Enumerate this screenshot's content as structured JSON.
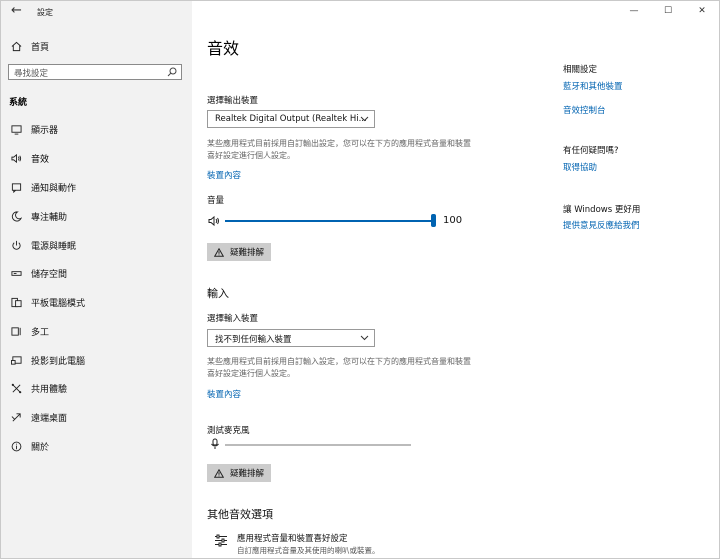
{
  "window": {
    "title": "設定",
    "back_glyph": "←",
    "minimize_glyph": "—",
    "maximize_glyph": "☐",
    "close_glyph": "✕"
  },
  "sidebar": {
    "home_label": "首頁",
    "search_placeholder": "尋找設定",
    "section_label": "系統",
    "items": [
      {
        "label": "顯示器",
        "icon": "monitor-icon"
      },
      {
        "label": "音效",
        "icon": "speaker-icon"
      },
      {
        "label": "通知與動作",
        "icon": "notification-icon"
      },
      {
        "label": "專注輔助",
        "icon": "moon-icon"
      },
      {
        "label": "電源與睡眠",
        "icon": "power-icon"
      },
      {
        "label": "儲存空間",
        "icon": "storage-icon"
      },
      {
        "label": "平板電腦模式",
        "icon": "tablet-icon"
      },
      {
        "label": "多工",
        "icon": "multitask-icon"
      },
      {
        "label": "投影到此電腦",
        "icon": "project-icon"
      },
      {
        "label": "共用體驗",
        "icon": "shared-icon"
      },
      {
        "label": "遠端桌面",
        "icon": "remote-icon"
      },
      {
        "label": "關於",
        "icon": "info-icon"
      }
    ]
  },
  "main": {
    "title": "音效",
    "output": {
      "select_label": "選擇輸出裝置",
      "device_value": "Realtek Digital Output (Realtek Hi...",
      "description": "某些應用程式目前採用自訂輸出設定，您可以在下方的應用程式音量和裝置喜好設定進行個人設定。",
      "device_props_link": "裝置內容",
      "volume_label": "音量",
      "volume_value": "100",
      "volume_level": 1.0,
      "troubleshoot_label": "疑難排解"
    },
    "input": {
      "heading": "輸入",
      "select_label": "選擇輸入裝置",
      "device_value": "找不到任何輸入裝置",
      "description": "某些應用程式目前採用自訂輸入設定，您可以在下方的應用程式音量和裝置喜好設定進行個人設定。",
      "device_props_link": "裝置內容",
      "mic_test_label": "測試麥克風",
      "troubleshoot_label": "疑難排解"
    },
    "other": {
      "heading": "其他音效選項",
      "app_volume_title": "應用程式音量和裝置喜好設定",
      "app_volume_sub": "自訂應用程式音量及其使用的喇叭或裝置。"
    }
  },
  "related": {
    "heading": "相關設定",
    "links": [
      "藍牙和其他裝置",
      "音效控制台"
    ],
    "help_heading": "有任何疑問嗎?",
    "help_link": "取得協助",
    "feedback_heading": "讓 Windows 更好用",
    "feedback_link": "提供意見反應給我們"
  },
  "colors": {
    "accent": "#0063b1",
    "sidebar_bg": "#f2f2f2",
    "button_bg": "#cccccc"
  }
}
